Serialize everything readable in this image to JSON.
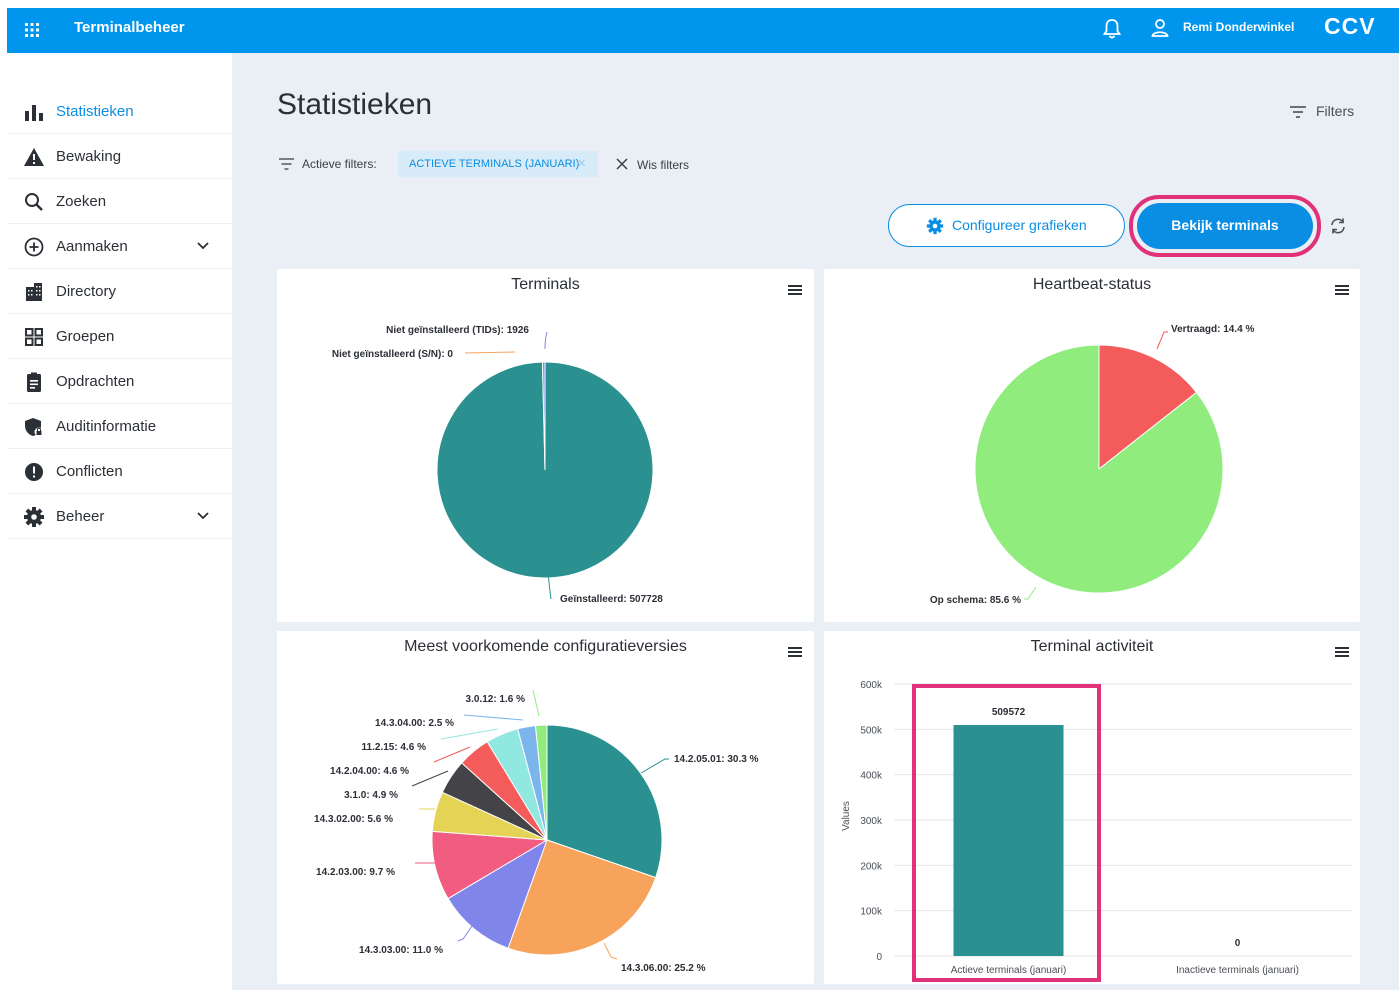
{
  "app": {
    "title": "Terminalbeheer",
    "user": "Remi Donderwinkel",
    "logo": "CCV"
  },
  "sidebar": {
    "items": [
      {
        "label": "Statistieken",
        "icon": "bar-chart-icon",
        "active": true
      },
      {
        "label": "Bewaking",
        "icon": "warning-icon"
      },
      {
        "label": "Zoeken",
        "icon": "search-icon"
      },
      {
        "label": "Aanmaken",
        "icon": "plus-circle-icon",
        "expandable": true
      },
      {
        "label": "Directory",
        "icon": "building-icon"
      },
      {
        "label": "Groepen",
        "icon": "grid-icon"
      },
      {
        "label": "Opdrachten",
        "icon": "clipboard-icon"
      },
      {
        "label": "Auditinformatie",
        "icon": "shield-lock-icon"
      },
      {
        "label": "Conflicten",
        "icon": "alert-circle-icon"
      },
      {
        "label": "Beheer",
        "icon": "gear-icon",
        "expandable": true
      }
    ]
  },
  "page": {
    "title": "Statistieken",
    "filters_label": "Filters",
    "active_filters_label": "Actieve filters:",
    "active_filter_chip": "ACTIEVE TERMINALS (JANUARI)",
    "clear_filters_label": "Wis filters",
    "configure_button": "Configureer grafieken",
    "view_terminals_button": "Bekijk terminals"
  },
  "colors": {
    "accent": "#0a8ee3",
    "highlight": "#e0317a",
    "teal": "#2a9090",
    "green": "#90ed7d",
    "red": "#f45b5b"
  },
  "chart_data": [
    {
      "type": "pie",
      "title": "Terminals",
      "slices": [
        {
          "name": "Geïnstalleerd",
          "value": 507728,
          "color": "#2a9090",
          "label": "Geïnstalleerd: 507728"
        },
        {
          "name": "Niet geïnstalleerd (TIDs)",
          "value": 1926,
          "color": "#8085e9",
          "label": "Niet geïnstalleerd (TIDs): 1926"
        },
        {
          "name": "Niet geïnstalleerd (S/N)",
          "value": 0,
          "color": "#f7a35c",
          "label": "Niet geïnstalleerd (S/N): 0"
        }
      ]
    },
    {
      "type": "pie",
      "title": "Heartbeat-status",
      "slices": [
        {
          "name": "Vertraagd",
          "value": 14.4,
          "color": "#f45b5b",
          "label": "Vertraagd: 14.4 %"
        },
        {
          "name": "Op schema",
          "value": 85.6,
          "color": "#90ed7d",
          "label": "Op schema: 85.6 %"
        }
      ]
    },
    {
      "type": "pie",
      "title": "Meest voorkomende configuratieversies",
      "slices": [
        {
          "name": "14.2.05.01",
          "value": 30.3,
          "color": "#2a9090",
          "label": "14.2.05.01: 30.3 %"
        },
        {
          "name": "14.3.06.00",
          "value": 25.2,
          "color": "#f7a35c",
          "label": "14.3.06.00: 25.2 %"
        },
        {
          "name": "14.3.03.00",
          "value": 11.0,
          "color": "#8085e9",
          "label": "14.3.03.00: 11.0 %"
        },
        {
          "name": "14.2.03.00",
          "value": 9.7,
          "color": "#f15c80",
          "label": "14.2.03.00: 9.7 %"
        },
        {
          "name": "14.3.02.00",
          "value": 5.6,
          "color": "#e4d354",
          "label": "14.3.02.00: 5.6 %"
        },
        {
          "name": "3.1.0",
          "value": 4.9,
          "color": "#434348",
          "label": "3.1.0: 4.9 %"
        },
        {
          "name": "14.2.04.00",
          "value": 4.6,
          "color": "#f45b5b",
          "label": "14.2.04.00: 4.6 %"
        },
        {
          "name": "11.2.15",
          "value": 4.6,
          "color": "#91e8e1",
          "label": "11.2.15: 4.6 %"
        },
        {
          "name": "14.3.04.00",
          "value": 2.5,
          "color": "#7cb5ec",
          "label": "14.3.04.00: 2.5 %"
        },
        {
          "name": "3.0.12",
          "value": 1.6,
          "color": "#90ed7d",
          "label": "3.0.12: 1.6 %"
        }
      ]
    },
    {
      "type": "bar",
      "title": "Terminal activiteit",
      "ylabel": "Values",
      "categories": [
        "Actieve terminals (januari)",
        "Inactieve terminals (januari)"
      ],
      "values": [
        509572,
        0
      ],
      "value_labels": [
        "509572",
        "0"
      ],
      "ylim": [
        0,
        600000
      ],
      "yticks": [
        "0",
        "100k",
        "200k",
        "300k",
        "400k",
        "500k",
        "600k"
      ],
      "color": "#2a9090",
      "grid": true
    }
  ]
}
